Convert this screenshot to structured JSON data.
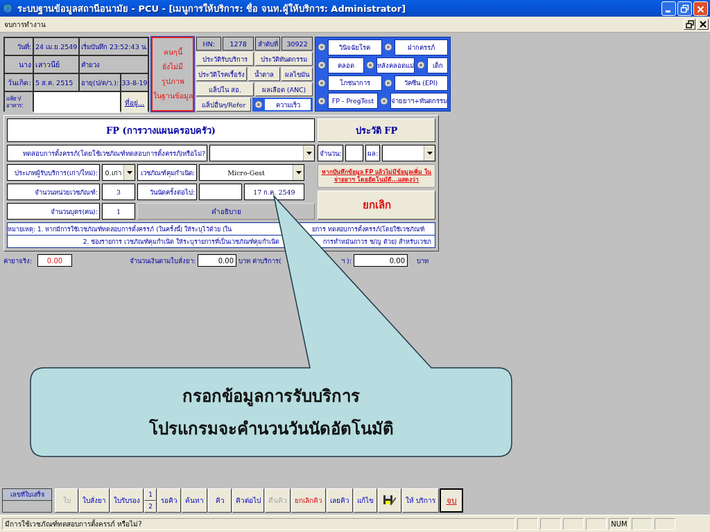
{
  "window": {
    "title": "ระบบฐานข้อมูลสถานีอนามัย - PCU - [เมนูการให้บริการ: ชื่อ จนท.ผู้ให้บริการ: Administrator]"
  },
  "menu": [
    {
      "label": "จบการทำงาน"
    }
  ],
  "patient": {
    "date_label": "วันที่:",
    "date": "24 เม.ย.2549",
    "start": "เริ่มบันทึก 23:52:43 น.",
    "prefix": "นาง",
    "first_name": "เสาวนีย์",
    "last_name": "คำยวง",
    "birth_label": "วันเกิด:",
    "birth": "5 ส.ค. 2515",
    "age_label": "อายุ(ป/ด/ว.):",
    "age": "33-8-19",
    "allergy_label": "แพ้ยา/อาหาร:",
    "address_link": "ที่อยู่..."
  },
  "photo_notice": {
    "lines": [
      "คนๆนี้",
      "ยังไม่มี",
      "รูปภาพ",
      "ในฐานข้อมูล"
    ]
  },
  "visit": {
    "hn_label": "HN:",
    "hn": "1278",
    "seq_label": "ลำดับที่",
    "seq": "30922"
  },
  "history_rows": [
    {
      "items": [
        {
          "label": "ประวัติรับบริการ",
          "kind": "button"
        },
        {
          "label": "ประวัติทันตกรรม",
          "kind": "button"
        }
      ]
    },
    {
      "items": [
        {
          "label": "ประวัติโรคเรื้อรัง",
          "kind": "button"
        },
        {
          "label": "น้ำตาล",
          "kind": "button"
        },
        {
          "label": "ผลไขมัน",
          "kind": "button"
        }
      ]
    },
    {
      "items": [
        {
          "label": "แล็ปใน สอ.",
          "kind": "button"
        },
        {
          "label": "ผลเลือด (ANC)",
          "kind": "button"
        }
      ]
    },
    {
      "items": [
        {
          "label": "แล็ปอื่นๆ/Refer",
          "kind": "button"
        },
        {
          "label": "ความเร็ว",
          "kind": "option"
        }
      ]
    }
  ],
  "services": [
    {
      "items": [
        {
          "label": "วินิจฉัยโรค"
        },
        {
          "label": "ฝากครรภ์"
        }
      ]
    },
    {
      "items": [
        {
          "label": "คลอด"
        },
        {
          "label": "หลังคลอดแม่"
        },
        {
          "label": "เด็ก"
        }
      ]
    },
    {
      "items": [
        {
          "label": "โภชนาการ"
        },
        {
          "label": "วัคซีน (EPI)"
        }
      ]
    },
    {
      "items": [
        {
          "label": "FP - PregTest"
        },
        {
          "label": "จ่ายยาฯ+ทันตกรรม"
        }
      ]
    }
  ],
  "fp_form": {
    "title": "FP (การวางแผนครอบครัว)",
    "history_button": "ประวัติ FP",
    "preg_test": {
      "label": "ทดสอบการตั้งครรภ์(โดยใช้เวชภัณฑ์ทดสอบการตั้งครรภ์)หรือไม่?"
    },
    "count": {
      "label": "จำนวน:"
    },
    "result": {
      "label": "ผล:"
    },
    "client_type": {
      "label": "ประเภทผู้รับบริการ(เก่า/ใหม่):",
      "value": "0.เก่า"
    },
    "contraceptive": {
      "label": "เวชภัณฑ์คุมกำเนิด:",
      "value": "Micro-Gest"
    },
    "units": {
      "label": "จำนวนหน่วยเวชภัณฑ์:",
      "value": "3"
    },
    "next_appointment": {
      "label": "วันนัดครั้งต่อไป:",
      "value": "17 ก.ค. 2549"
    },
    "children": {
      "label": "จำนวนบุตร(คน):",
      "value": "1"
    },
    "explain_button": "คำอธิบาย",
    "warning_link": "หากบันทึกข้อมูล FP แล้วไม่มีข้อมูลเพิ่ม ในจ่ายยาฯ โดยอัตโนมัติ...แสดงว่า",
    "cancel_button": "ยกเลิก",
    "notes": [
      {
        "left": "หมายเหตุ: 1. หากมีการใช้เวชภัณฑ์ทดสอบการตั้งครรภ์ (ในครั้งนี้) ให้ระบุไว้ด้วย (ใน",
        "right": "ยการ  ทดสอบการตั้งครรภ์(โดยใช้เวชภัณฑ์"
      },
      {
        "left": "2. ช่องรายการ เวชภัณฑ์คุมกำเนิด ให้ระบุรายการที่เป็นเวชภัณฑ์คุมกำเนิด",
        "right": "การทำหมันถาวร ช/ญ ด้วย) สำหรับเวชภ"
      }
    ]
  },
  "fees": {
    "actual_label": "ค่ายาจริง:",
    "actual": "0.00",
    "order_label": "จำนวนเงินตามใบสั่งยา:",
    "order": "0.00",
    "order_unit_service": "บาท ค่าบริการ(",
    "service_label_end": "ฯ ):",
    "service": "0.00",
    "service_unit": "บาท"
  },
  "callout": {
    "lines": [
      "กรอกข้อมูลการรับบริการ",
      "โปรแกรมจะคำนวนวันนัดอัตโนมัติ"
    ]
  },
  "toolbar": {
    "receipt_label": "เลขที่ใบเสร็จ",
    "buttons": [
      {
        "kind": "text",
        "label": "ใบ",
        "disabled": true
      },
      {
        "kind": "text",
        "label": "ใบสั่งยา",
        "disabled": false
      },
      {
        "kind": "text",
        "label": "ใบรับรอง",
        "disabled": false
      },
      {
        "kind": "split",
        "labels": [
          "1",
          "2"
        ],
        "disabled": false
      },
      {
        "kind": "text",
        "label": "รอคิว",
        "disabled": false
      },
      {
        "kind": "text",
        "label": "ค้นหา",
        "disabled": false
      },
      {
        "kind": "text",
        "label": "คิว",
        "disabled": false
      },
      {
        "kind": "text",
        "label": "คิวต่อไป",
        "disabled": false
      },
      {
        "kind": "text",
        "label": "คืนคิว",
        "disabled": true
      },
      {
        "kind": "danger",
        "label": "ยกเลิกคิว",
        "disabled": false
      },
      {
        "kind": "text",
        "label": "เลยคิว",
        "disabled": false
      },
      {
        "kind": "text",
        "label": "แก้ไข",
        "disabled": false
      },
      {
        "kind": "icon",
        "disabled": false
      },
      {
        "kind": "text",
        "label": "ให้ บริการ",
        "disabled": false
      },
      {
        "kind": "exit",
        "label": "จบ",
        "disabled": false
      }
    ]
  },
  "status_bar": {
    "message": "มีการใช้เวชภัณฑ์ทดสอบการตั้งครรภ์ หรือไม่?",
    "indicators": [
      {
        "label": "NUM"
      }
    ]
  }
}
